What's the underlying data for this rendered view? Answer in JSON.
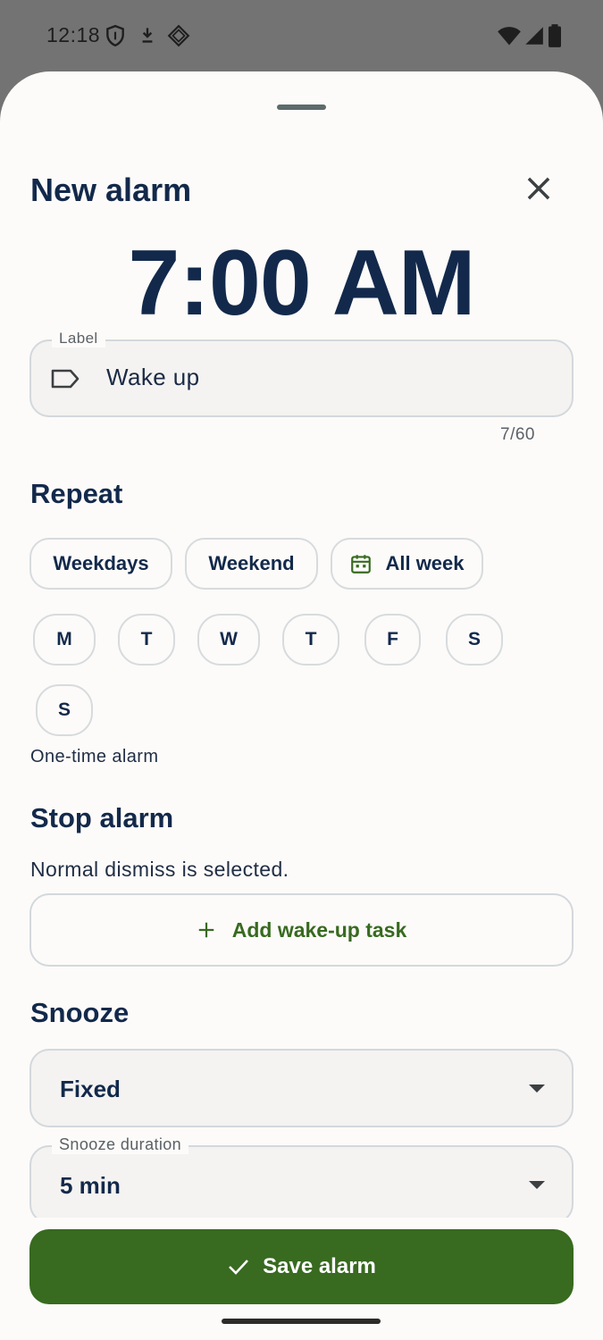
{
  "status_bar": {
    "time": "12:18",
    "left_icons": [
      "shield-icon",
      "download-icon",
      "navigation-diamond-icon"
    ],
    "right_icons": [
      "wifi-icon",
      "signal-icon",
      "battery-icon"
    ]
  },
  "sheet": {
    "title": "New alarm",
    "close_icon": "close-icon",
    "time": "7:00 AM"
  },
  "label_field": {
    "legend": "Label",
    "icon": "label-tag-icon",
    "value": "Wake up",
    "counter": "7/60"
  },
  "repeat": {
    "title": "Repeat",
    "presets": [
      {
        "label": "Weekdays"
      },
      {
        "label": "Weekend"
      },
      {
        "label": "All week",
        "icon": "calendar-icon"
      }
    ],
    "days": [
      "M",
      "T",
      "W",
      "T",
      "F",
      "S",
      "S"
    ],
    "hint": "One-time alarm"
  },
  "stop_alarm": {
    "title": "Stop alarm",
    "description": "Normal dismiss is selected.",
    "add_task_label": "Add wake-up task",
    "add_task_icon": "plus-icon"
  },
  "snooze": {
    "title": "Snooze",
    "mode_value": "Fixed",
    "duration_legend": "Snooze duration",
    "duration_value": "5 min"
  },
  "save": {
    "label": "Save alarm",
    "icon": "check-icon"
  },
  "colors": {
    "primary_text": "#13294b",
    "accent_green": "#386a20",
    "sheet_bg": "#fcfbf9",
    "scrim": "#737373"
  }
}
